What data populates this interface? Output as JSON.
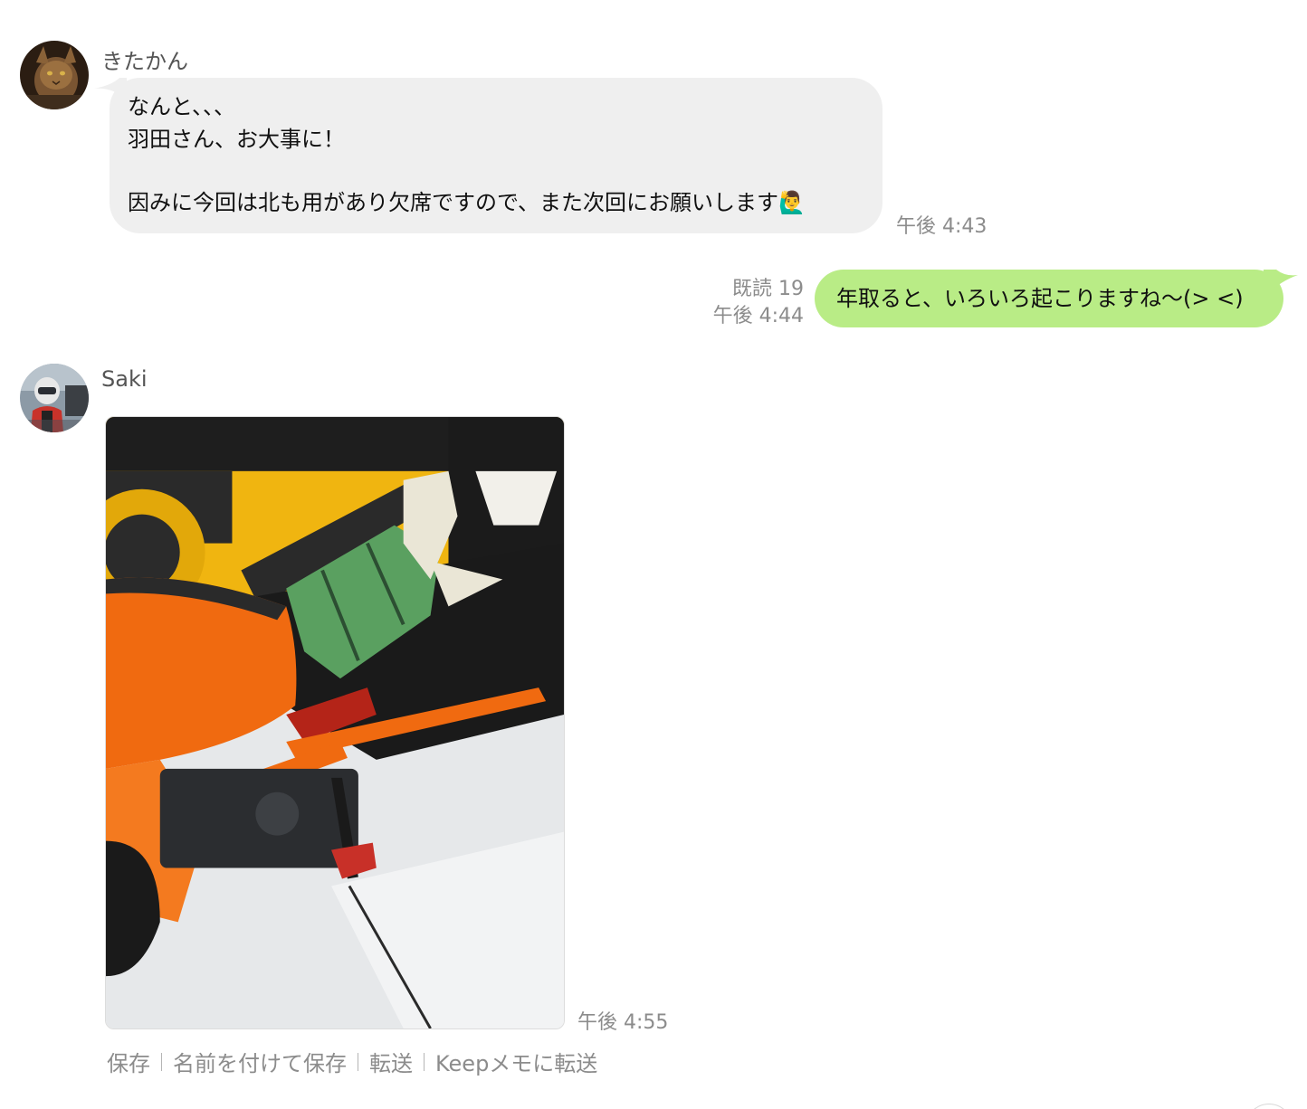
{
  "messages": {
    "first": {
      "sender": "きたかん",
      "lines": [
        "なんと、、、",
        "羽田さん、お大事に！",
        "因みに今回は北も用があり欠席ですので、また次回にお願いします🙋‍♂️"
      ],
      "time": "午後 4:43"
    },
    "second": {
      "text": "年取ると、いろいろ起こりますね〜(> <)",
      "read": "既読 19",
      "time": "午後 4:44"
    },
    "third": {
      "sender": "Saki",
      "time": "午後 4:55"
    }
  },
  "photo_actions": {
    "save": "保存",
    "save_as": "名前を付けて保存",
    "forward": "転送",
    "keep": "Keepメモに転送"
  },
  "colors": {
    "incoming_bubble": "#efefef",
    "outgoing_bubble": "#b9ec86",
    "meta_text": "#8c8c8c"
  }
}
